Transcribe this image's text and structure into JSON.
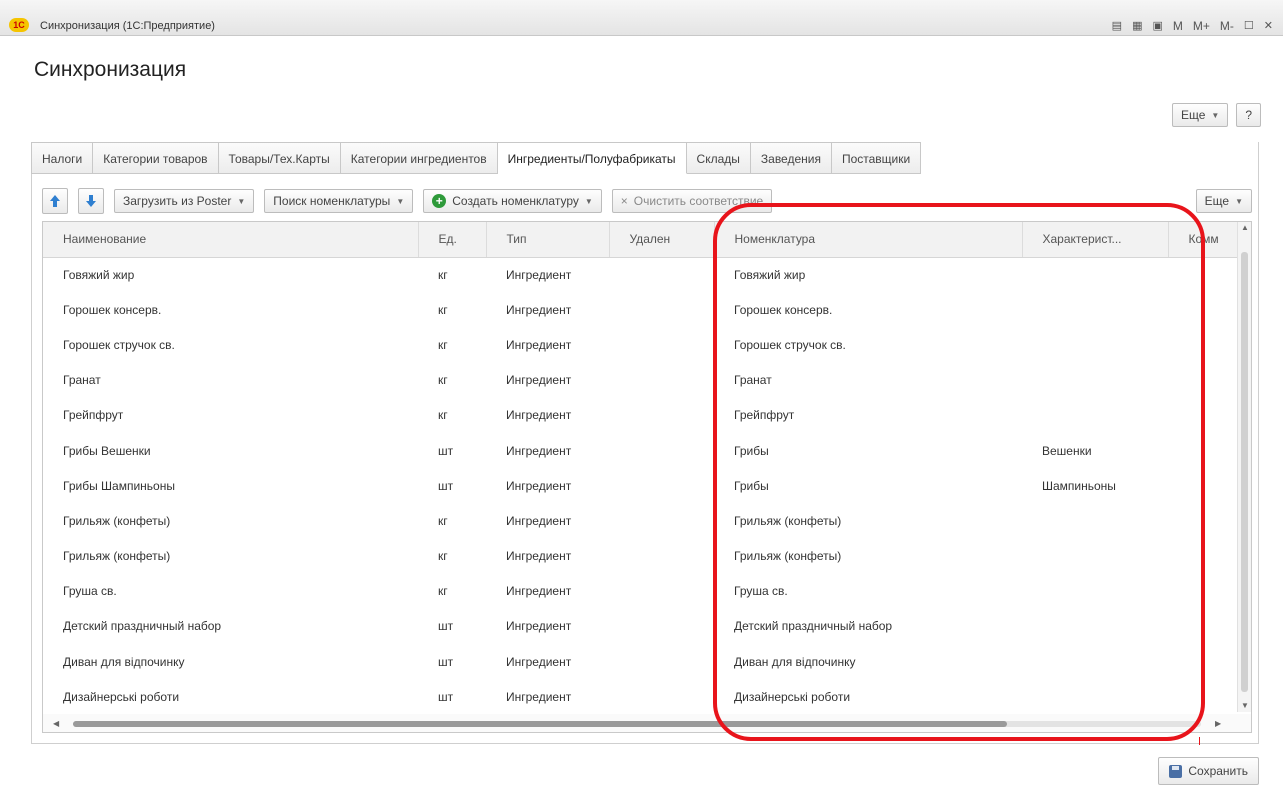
{
  "window": {
    "title": "Синхронизация (1С:Предприятие)",
    "logo_text": "1С",
    "controls": [
      "M",
      "M+",
      "M-"
    ]
  },
  "page": {
    "title": "Синхронизация",
    "more_label": "Еще",
    "help_label": "?"
  },
  "tabs": [
    {
      "label": "Налоги"
    },
    {
      "label": "Категории товаров"
    },
    {
      "label": "Товары/Тех.Карты"
    },
    {
      "label": "Категории ингредиентов"
    },
    {
      "label": "Ингредиенты/Полуфабрикаты",
      "active": true
    },
    {
      "label": "Склады"
    },
    {
      "label": "Заведения"
    },
    {
      "label": "Поставщики"
    }
  ],
  "toolbar": {
    "load_label": "Загрузить из Poster",
    "search_label": "Поиск номенклатуры",
    "create_label": "Создать номенклатуру",
    "clear_label": "Очистить соответствие",
    "more_label": "Еще"
  },
  "table": {
    "columns": [
      "Наименование",
      "Ед.",
      "Тип",
      "Удален",
      "Номенклатура",
      "Характерист...",
      "Комм"
    ],
    "rows": [
      [
        "Говяжий жир",
        "кг",
        "Ингредиент",
        "",
        "Говяжий жир",
        ""
      ],
      [
        "Горошек консерв.",
        "кг",
        "Ингредиент",
        "",
        "Горошек консерв.",
        ""
      ],
      [
        "Горошек стручок св.",
        "кг",
        "Ингредиент",
        "",
        "Горошек стручок св.",
        ""
      ],
      [
        "Гранат",
        "кг",
        "Ингредиент",
        "",
        "Гранат",
        ""
      ],
      [
        "Грейпфрут",
        "кг",
        "Ингредиент",
        "",
        "Грейпфрут",
        ""
      ],
      [
        "Грибы Вешенки",
        "шт",
        "Ингредиент",
        "",
        "Грибы",
        "Вешенки"
      ],
      [
        "Грибы Шампиньоны",
        "шт",
        "Ингредиент",
        "",
        "Грибы",
        "Шампиньоны"
      ],
      [
        "Грильяж (конфеты)",
        "кг",
        "Ингредиент",
        "",
        "Грильяж (конфеты)",
        ""
      ],
      [
        "Грильяж (конфеты)",
        "кг",
        "Ингредиент",
        "",
        "Грильяж (конфеты)",
        ""
      ],
      [
        "Груша св.",
        "кг",
        "Ингредиент",
        "",
        "Груша св.",
        ""
      ],
      [
        "Детский праздничный набор",
        "шт",
        "Ингредиент",
        "",
        "Детский праздничный набор",
        ""
      ],
      [
        "Диван для відпочинку",
        "шт",
        "Ингредиент",
        "",
        "Диван для відпочинку",
        ""
      ],
      [
        "Дизайнерські роботи",
        "шт",
        "Ингредиент",
        "",
        "Дизайнерські роботи",
        ""
      ]
    ]
  },
  "footer": {
    "save_label": "Сохранить"
  },
  "colors": {
    "highlight": "#e8141b",
    "create_icon": "#2e9a3a",
    "arrow_icon": "#2f7fd0"
  }
}
